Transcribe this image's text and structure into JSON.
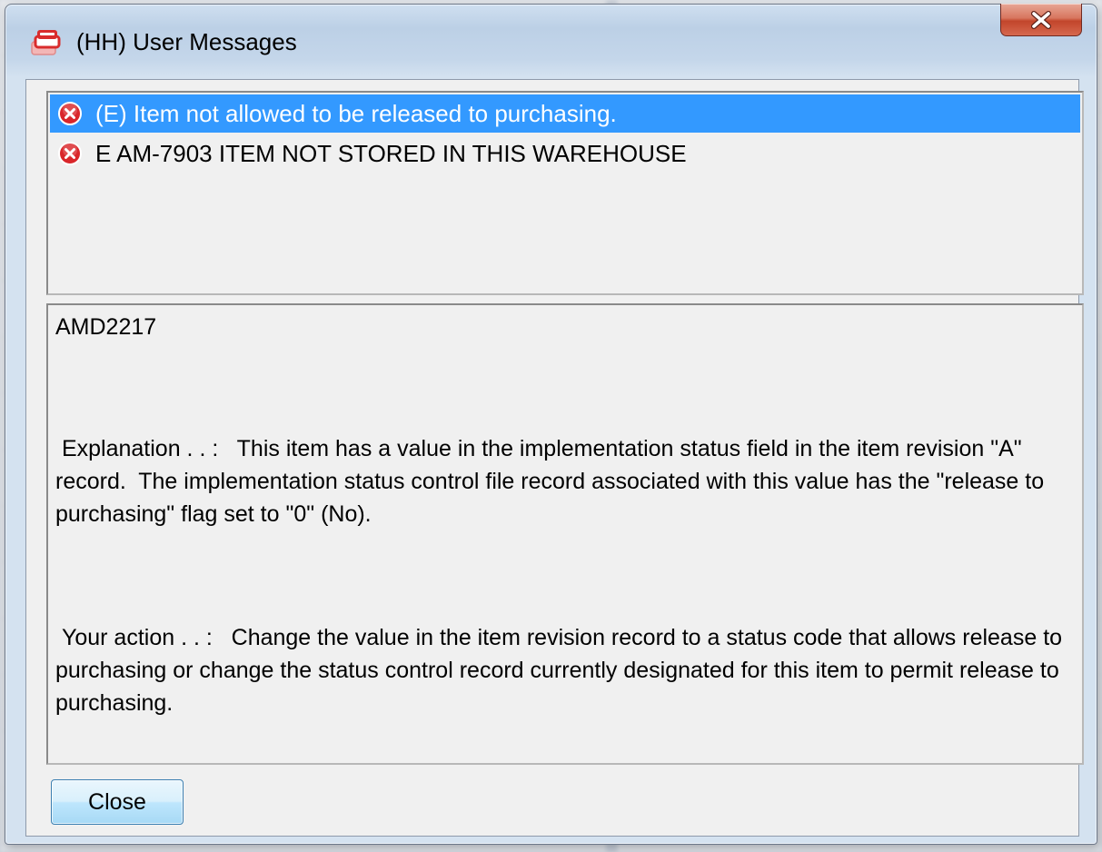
{
  "window": {
    "title": "(HH) User Messages",
    "app_icon": "database-stack-icon",
    "close_glyph": "X"
  },
  "messages": [
    {
      "text": "(E) Item not allowed to be released to purchasing.",
      "icon": "error-circle-icon",
      "selected": true
    },
    {
      "text": "E AM-7903 ITEM NOT STORED IN THIS WAREHOUSE",
      "icon": "error-circle-icon",
      "selected": false
    }
  ],
  "detail": {
    "code": "AMD2217",
    "explanation": " Explanation . . :   This item has a value in the implementation status field in the item revision \"A\" record.  The implementation status control file record associated with this value has the \"release to purchasing\" flag set to \"0\" (No).",
    "action": " Your action . . :   Change the value in the item revision record to a status code that allows release to purchasing or change the status control record currently designated for this item to permit release to purchasing."
  },
  "buttons": {
    "close_label": "Close"
  },
  "colors": {
    "selection": "#3399ff",
    "error_icon": "#d9262a"
  }
}
